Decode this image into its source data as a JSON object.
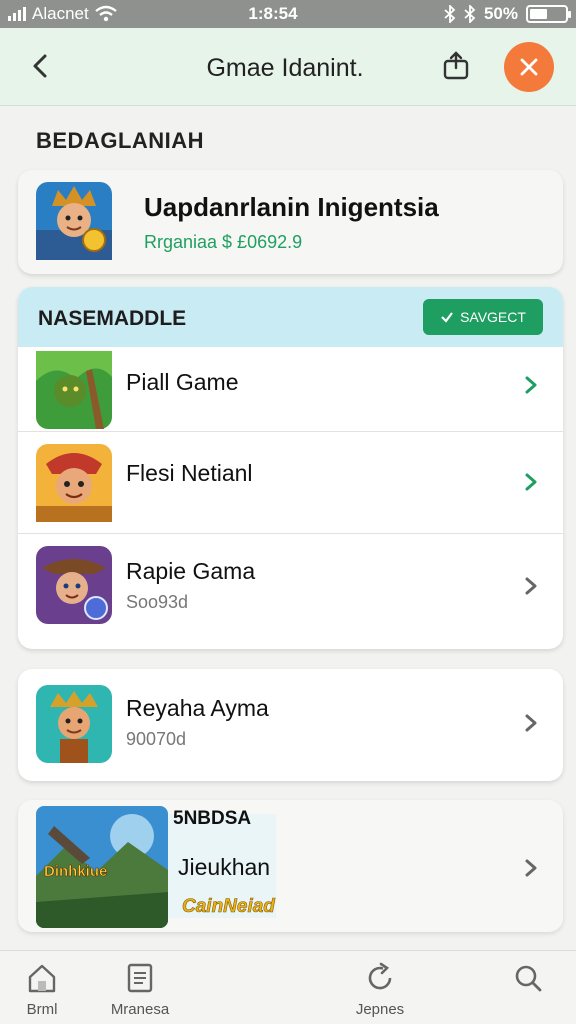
{
  "status_bar": {
    "carrier": "Alacnet",
    "time": "1:8:54",
    "battery": "50%",
    "battery_level": 0.5
  },
  "header": {
    "title": "Gmae Idanint.",
    "back_icon": "chevron-left-icon",
    "share_icon": "share-icon",
    "close_icon": "close-icon",
    "close_color": "#f47a3c"
  },
  "section_title": "BEDAGLANIAH",
  "featured": {
    "title": "Uapdanrlanin Inigentsia",
    "subtitle": "Rrganiaa $ £0692.9",
    "subtitle_color": "#20a060"
  },
  "list": {
    "heading": "NASEMADDLE",
    "action_label": "SAVGECT",
    "action_color": "#1e9e61",
    "items": [
      {
        "title": "Piall Game",
        "subtitle": "",
        "chevron": "green"
      },
      {
        "title": "Flesi Netianl",
        "subtitle": "",
        "chevron": "green"
      },
      {
        "title": "Rapie Gama",
        "subtitle": "Soo93d",
        "chevron": "gray"
      }
    ]
  },
  "solo_item": {
    "title": "Reyaha Ayma",
    "subtitle": "90070d"
  },
  "banner": {
    "label": "5NBDSA",
    "title": "Jieukhan",
    "image_text": "Dinhkiue",
    "logo_text": "CainNeiad"
  },
  "bottom_nav": [
    {
      "label": "Brml",
      "icon": "home-icon"
    },
    {
      "label": "Mranesa",
      "icon": "document-icon"
    },
    {
      "label": "Jepnes",
      "icon": "refresh-icon"
    },
    {
      "label": "",
      "icon": "search-icon"
    }
  ],
  "colors": {
    "accent_green": "#1e9e61",
    "header_bg": "#e6f4ea",
    "list_header_bg": "#c9ebf4"
  }
}
